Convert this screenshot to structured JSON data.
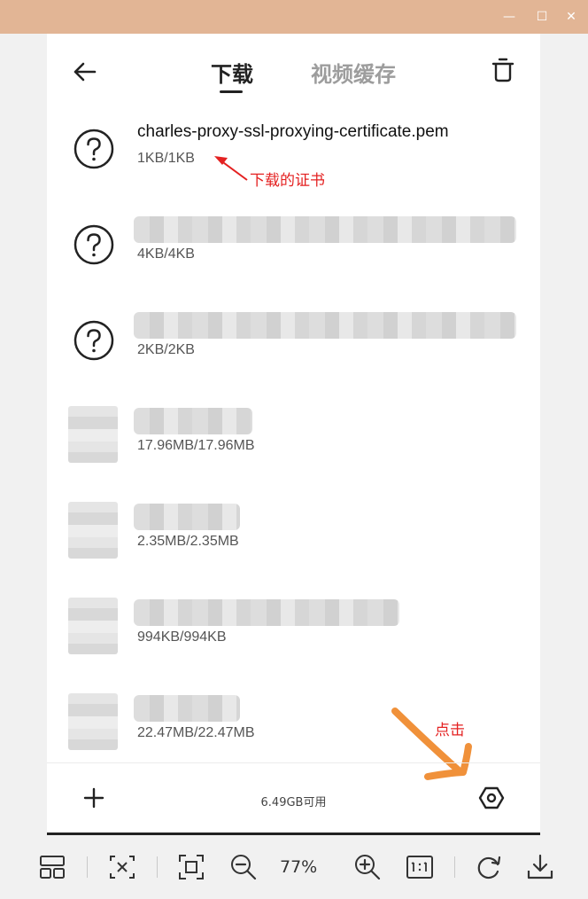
{
  "window": {
    "min_label": "—",
    "max_label": "☐",
    "close_label": "✕"
  },
  "header": {
    "tabs": [
      {
        "label": "下载",
        "active": true
      },
      {
        "label": "视频缓存",
        "active": false
      }
    ]
  },
  "downloads": [
    {
      "name": "charles-proxy-ssl-proxying-certificate.pem",
      "size": "1KB/1KB",
      "icon": "question-icon"
    },
    {
      "name": "",
      "size": "4KB/4KB",
      "icon": "question-icon"
    },
    {
      "name": "",
      "size": "2KB/2KB",
      "icon": "question-icon"
    },
    {
      "name": "",
      "size": "17.96MB/17.96MB",
      "icon": "thumbnail"
    },
    {
      "name": "",
      "size": "2.35MB/2.35MB",
      "icon": "thumbnail"
    },
    {
      "name": "",
      "size": "994KB/994KB",
      "icon": "thumbnail"
    },
    {
      "name": "",
      "size": "22.47MB/22.47MB",
      "icon": "thumbnail"
    }
  ],
  "annotations": {
    "certificate_note": "下载的证书",
    "click_note": "点击",
    "color": "#e42121",
    "arrow_color": "#f0913a"
  },
  "bottom_bar": {
    "storage": "6.49GB可用"
  },
  "toolbar": {
    "zoom": "77%"
  },
  "colors": {
    "titlebar": "#e2b595",
    "accent_text": "#222222",
    "inactive_tab": "#9d9d9d"
  }
}
